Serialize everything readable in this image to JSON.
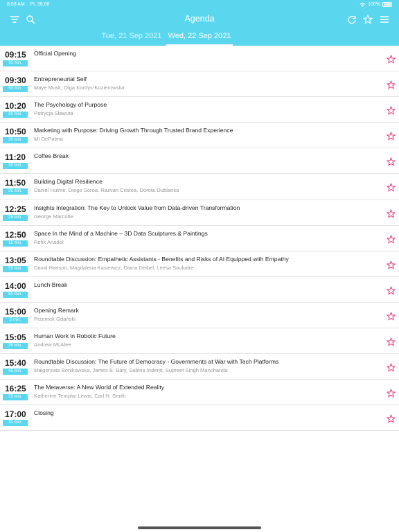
{
  "status_bar": {
    "time": "8:59 AM",
    "carrier": "PL 38,08",
    "battery": "100%"
  },
  "header": {
    "title": "Agenda"
  },
  "icons": {
    "filter": "filter-icon",
    "search": "search-icon",
    "refresh": "refresh-icon",
    "favorites": "star-outline-icon",
    "menu": "menu-icon",
    "favorite_toggle": "star-outline-icon"
  },
  "colors": {
    "accent": "#5ad7ee",
    "star": "#e8357a"
  },
  "date_tabs": [
    {
      "label": "Tue, 21 Sep 2021",
      "selected": false
    },
    {
      "label": "Wed, 22 Sep 2021",
      "selected": true
    }
  ],
  "sessions": [
    {
      "time": "09:15",
      "duration": "15 min.",
      "title": "Official Opening",
      "speakers": ""
    },
    {
      "time": "09:30",
      "duration": "50 min.",
      "title": "Entrepreneurial Self",
      "speakers": "Maye Musk, Olga Kordys-Kozierowska"
    },
    {
      "time": "10:20",
      "duration": "30 min.",
      "title": "The Psychology of Purpose",
      "speakers": "Patrycja Sławuta"
    },
    {
      "time": "10:50",
      "duration": "30 min.",
      "title": "Marketing with Purpose: Driving Growth Through Trusted Brand Experience",
      "speakers": "MI DePalma"
    },
    {
      "time": "11:20",
      "duration": "30 min.",
      "title": "Coffee Break",
      "speakers": ""
    },
    {
      "time": "11:50",
      "duration": "35 min.",
      "title": "Building Digital Resilience",
      "speakers": "Daniel Hulme, Diego Soroa, Razvan Cristea, Dorota Dublanka"
    },
    {
      "time": "12:25",
      "duration": "25 min.",
      "title": "Insights Integration: The Key to Unlock Value from Data-driven Transformation",
      "speakers": "George Marcotte"
    },
    {
      "time": "12:50",
      "duration": "15 min.",
      "title": "Space In the Mind of a Machine – 3D Data Sculptures & Paintings",
      "speakers": "Refik Anadol"
    },
    {
      "time": "13:05",
      "duration": "55 min.",
      "title": "Roundtable Discussion: Empathetic Assistants - Benefits and Risks of AI Equipped with Empathy",
      "speakers": "David Hanson, Magdalena Kasiewicz, Diana Deibel, Leesa Soulodre"
    },
    {
      "time": "14:00",
      "duration": "60 min.",
      "title": "Lunch Break",
      "speakers": ""
    },
    {
      "time": "15:00",
      "duration": "5 min.",
      "title": "Opening Remark",
      "speakers": "Przemek Gdański"
    },
    {
      "time": "15:05",
      "duration": "35 min.",
      "title": "Human Work in Robotic Future",
      "speakers": "Andrew McAfee"
    },
    {
      "time": "15:40",
      "duration": "45 min.",
      "title": "Roundtable Discussion: The Future of Democracy - Governments at War with Tech Platforms",
      "speakers": "Małgorzata Bonikowska, James B. Baty, Sabina Inderjit, Supreet Singh Manchanda"
    },
    {
      "time": "16:25",
      "duration": "35 min.",
      "title": "The Metaverse: A New World of Extended Reality",
      "speakers": "Katherine Templar Lewis, Carl H. Smith"
    },
    {
      "time": "17:00",
      "duration": "10 min.",
      "title": "Closing",
      "speakers": ""
    }
  ]
}
